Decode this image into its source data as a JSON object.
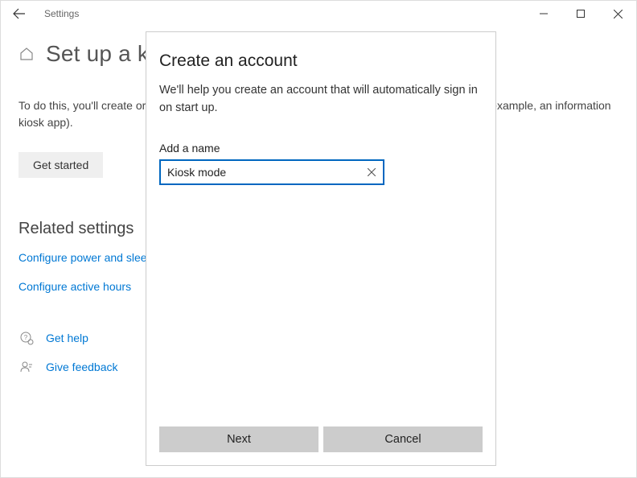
{
  "window": {
    "title": "Settings"
  },
  "page": {
    "title": "Set up a kiosk",
    "description": "To do this, you'll create or choose an account and then choose the only app that it can use (for example, an information kiosk app).",
    "getStarted": "Get started",
    "relatedHeading": "Related settings",
    "relLink1": "Configure power and sleep settings",
    "relLink2": "Configure active hours",
    "helpLink": "Get help",
    "feedbackLink": "Give feedback"
  },
  "dialog": {
    "title": "Create an account",
    "description": "We'll help you create an account that will automatically sign in on start up.",
    "fieldLabel": "Add a name",
    "nameValue": "Kiosk mode",
    "nextLabel": "Next",
    "cancelLabel": "Cancel"
  }
}
